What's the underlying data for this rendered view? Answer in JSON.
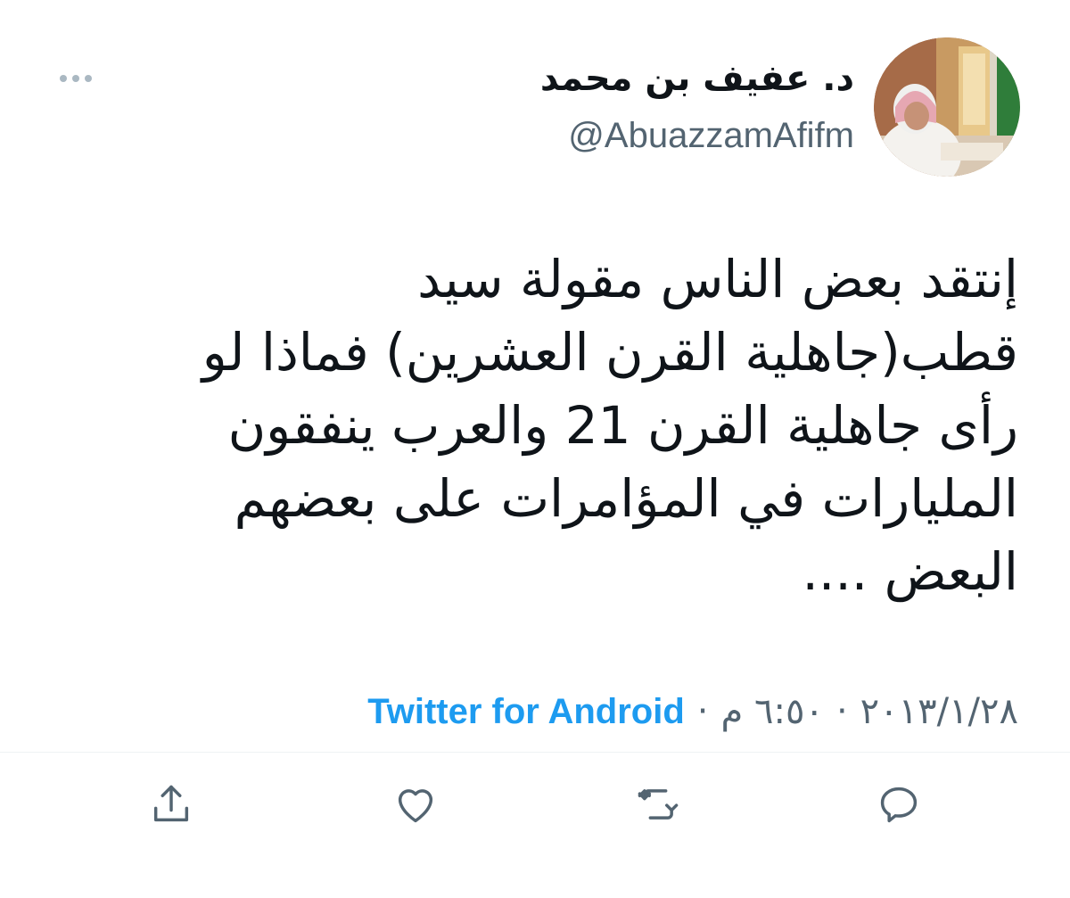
{
  "author": {
    "display_name": "د. عفيف بن محمد",
    "handle": "@AbuazzamAfifm"
  },
  "tweet": {
    "text": "إنتقد بعض الناس مقولة سيد\nقطب(جاهلية القرن العشرين) فماذا لو\nرأى جاهلية القرن 21 والعرب ينفقون\nالمليارات في المؤامرات على بعضهم\nالبعض ....",
    "date": "٢٠١٣/١/٢٨",
    "time": "٦:٥٠ م",
    "separator": "·",
    "source": "Twitter for Android"
  },
  "icons": {
    "more": "more-horizontal-icon",
    "reply": "reply-icon",
    "retweet": "retweet-icon",
    "like": "heart-icon",
    "share": "share-icon"
  },
  "colors": {
    "accent": "#1d9bf0",
    "secondary_text": "#536471",
    "primary_text": "#0f1419",
    "icon": "#536471"
  }
}
